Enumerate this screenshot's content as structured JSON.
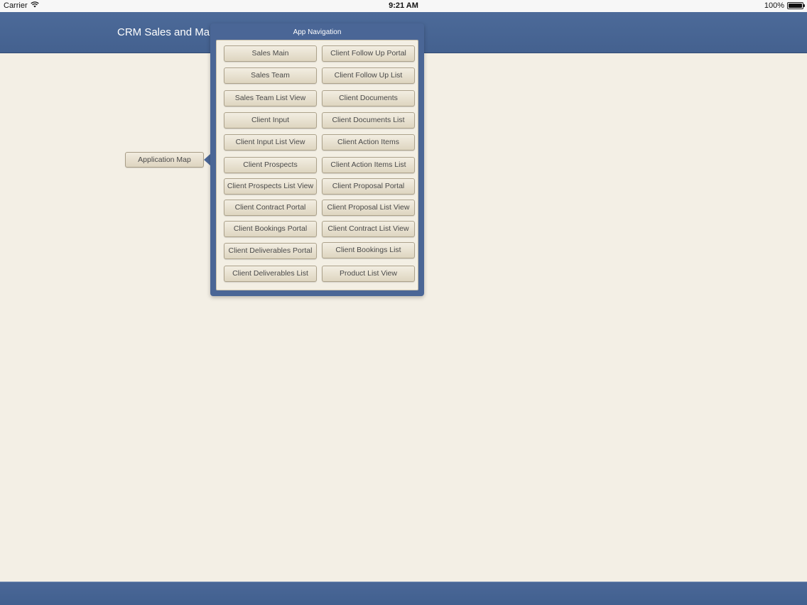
{
  "status_bar": {
    "carrier": "Carrier",
    "time": "9:21 AM",
    "battery": "100%"
  },
  "header": {
    "title": "CRM Sales and Ma"
  },
  "app_map_button": "Application Map",
  "popover": {
    "title": "App Navigation",
    "left_column": [
      "Sales Main",
      "Sales Team",
      "Sales Team List View",
      "Client Input",
      "Client Input List View",
      "Client Prospects",
      "Client Prospects List View",
      "Client Contract Portal",
      "Client Bookings Portal",
      "Client Deliverables Portal",
      "Client Deliverables List"
    ],
    "right_column": [
      "Client Follow Up Portal",
      "Client Follow Up List",
      "Client Documents",
      "Client Documents List",
      "Client Action Items",
      "Client Action Items List",
      "Client Proposal Portal",
      "Client Proposal List View",
      "Client Contract List View",
      "Client Bookings List",
      "Product List View"
    ]
  }
}
